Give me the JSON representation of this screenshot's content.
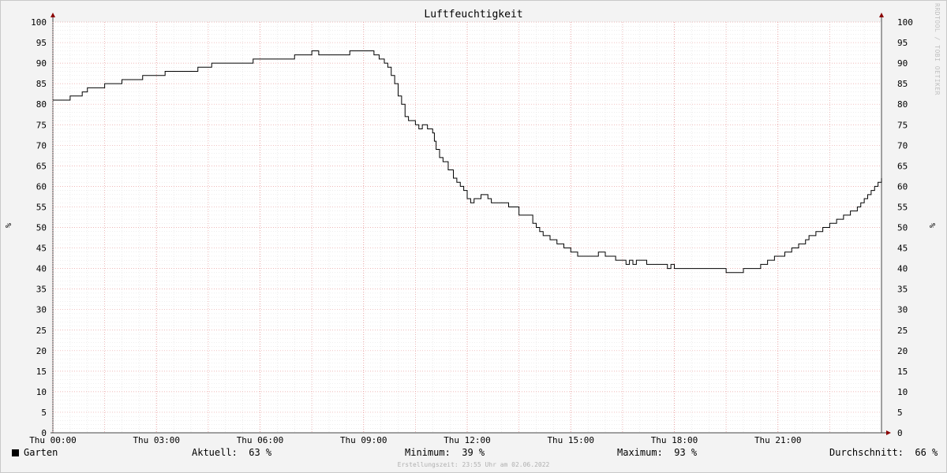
{
  "chart_data": {
    "type": "line",
    "title": "Luftfeuchtigkeit",
    "ylabel": "%",
    "ylim": [
      0,
      100
    ],
    "y_ticks": [
      0,
      5,
      10,
      15,
      20,
      25,
      30,
      35,
      40,
      45,
      50,
      55,
      60,
      65,
      70,
      75,
      80,
      85,
      90,
      95,
      100
    ],
    "x_tick_labels": [
      "Thu 00:00",
      "Thu 03:00",
      "Thu 06:00",
      "Thu 09:00",
      "Thu 12:00",
      "Thu 15:00",
      "Thu 18:00",
      "Thu 21:00"
    ],
    "x_ticks_hours": [
      0,
      3,
      6,
      9,
      12,
      15,
      18,
      21
    ],
    "xlim_hours": [
      0,
      24
    ],
    "grid": true,
    "series": [
      {
        "name": "Garten",
        "color": "#000000",
        "x_hours": [
          0,
          0.25,
          0.5,
          0.65,
          0.85,
          1,
          1.1,
          1.5,
          1.6,
          2,
          2.4,
          2.6,
          2.7,
          3.25,
          3.4,
          4.2,
          4.4,
          4.6,
          5.5,
          5.8,
          6.3,
          7.0,
          7.2,
          7.3,
          7.5,
          7.7,
          8.0,
          8.4,
          8.6,
          8.8,
          9.2,
          9.3,
          9.45,
          9.6,
          9.7,
          9.8,
          9.9,
          10.0,
          10.1,
          10.2,
          10.3,
          10.5,
          10.6,
          10.7,
          10.85,
          11.0,
          11.05,
          11.1,
          11.2,
          11.3,
          11.45,
          11.6,
          11.7,
          11.8,
          11.9,
          12.0,
          12.1,
          12.2,
          12.4,
          12.5,
          12.6,
          12.7,
          12.9,
          13.2,
          13.5,
          13.9,
          14.0,
          14.1,
          14.2,
          14.4,
          14.6,
          14.8,
          15.0,
          15.2,
          15.4,
          15.8,
          16.0,
          16.3,
          16.5,
          16.6,
          16.7,
          16.8,
          16.9,
          17.0,
          17.2,
          17.5,
          17.6,
          17.8,
          17.9,
          18.0,
          18.5,
          19.0,
          19.1,
          19.2,
          19.5,
          20.0,
          20.3,
          20.5,
          20.7,
          20.9,
          21.2,
          21.4,
          21.6,
          21.8,
          21.9,
          22.1,
          22.3,
          22.5,
          22.7,
          22.9,
          23.1,
          23.3,
          23.4,
          23.5,
          23.6,
          23.7,
          23.8,
          23.9,
          24.0
        ],
        "values": [
          81,
          81,
          82,
          82,
          83,
          84,
          84,
          85,
          85,
          86,
          86,
          87,
          87,
          88,
          88,
          89,
          89,
          90,
          90,
          91,
          91,
          92,
          92,
          92,
          93,
          92,
          92,
          92,
          93,
          93,
          93,
          92,
          91,
          90,
          89,
          87,
          85,
          82,
          80,
          77,
          76,
          75,
          74,
          75,
          74,
          73,
          71,
          69,
          67,
          66,
          64,
          62,
          61,
          60,
          59,
          57,
          56,
          57,
          58,
          58,
          57,
          56,
          56,
          55,
          53,
          51,
          50,
          49,
          48,
          47,
          46,
          45,
          44,
          43,
          43,
          44,
          43,
          42,
          42,
          41,
          42,
          41,
          42,
          42,
          41,
          41,
          41,
          40,
          41,
          40,
          40,
          40,
          40,
          40,
          39,
          40,
          40,
          41,
          42,
          43,
          44,
          45,
          46,
          47,
          48,
          49,
          50,
          51,
          52,
          53,
          54,
          55,
          56,
          57,
          58,
          59,
          60,
          61,
          62,
          63
        ]
      }
    ],
    "legend": {
      "series_name": "Garten",
      "aktuell": "Aktuell:  63 %",
      "minimum": "Minimum:  39 %",
      "maximum": "Maximum:  93 %",
      "durchschnitt": "Durchschnitt:  66 %"
    },
    "footer": "Erstellungszeit: 23:55 Uhr am 02.06.2022",
    "watermark": "RRDTOOL / TOBI OETIKER"
  }
}
